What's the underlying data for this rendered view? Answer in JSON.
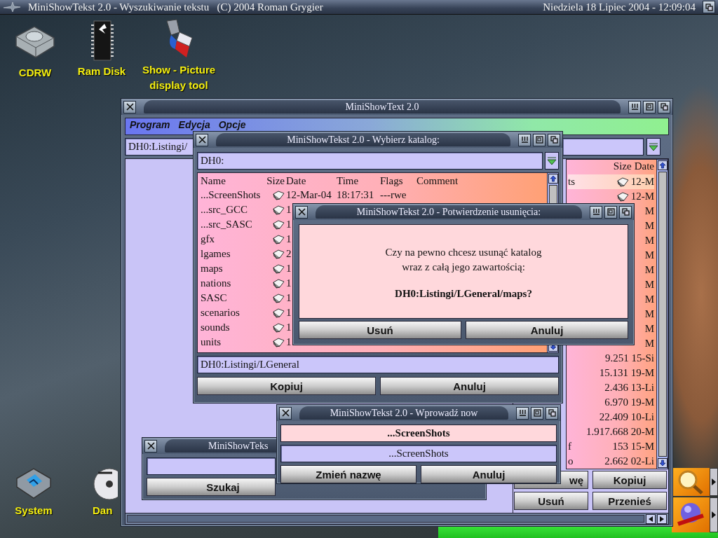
{
  "screen_bar": {
    "title": "MiniShowTekst 2.0 - Wyszukiwanie tekstu   (C) 2004 Roman Grygier",
    "clock": "Niedziela 18 Lipiec 2004 - 12:09:04"
  },
  "desktop_icons": [
    {
      "label": "CDRW",
      "kind": "cdrw"
    },
    {
      "label": "Ram Disk",
      "kind": "ram"
    },
    {
      "label": "Show - Picture display tool",
      "kind": "picture"
    },
    {
      "label": "System",
      "kind": "system"
    },
    {
      "label": "Dan",
      "kind": "cd"
    }
  ],
  "main_window": {
    "title": "MiniShowText 2.0",
    "menu": [
      "Program",
      "Edycja",
      "Opcje"
    ],
    "path": "DH0:Listingi/",
    "list_header": [
      "Size",
      "Date"
    ],
    "list_rows": [
      {
        "name": "ts",
        "size_date": "12-M",
        "kind": "dir",
        "selected": true
      },
      {
        "size_date": "12-M",
        "kind": "dir",
        "selected": false
      },
      {
        "size_date": "M",
        "kind": "file",
        "selected": false
      },
      {
        "size_date": "M",
        "kind": "file",
        "selected": false
      },
      {
        "size_date": "M",
        "kind": "file",
        "selected": false
      },
      {
        "size_date": "M",
        "kind": "file",
        "selected": false
      },
      {
        "size_date": "M",
        "kind": "file",
        "selected": false
      },
      {
        "size_date": "M",
        "kind": "file",
        "selected": false
      },
      {
        "size_date": "M",
        "kind": "file",
        "selected": false
      },
      {
        "size_date": "M",
        "kind": "file",
        "selected": false
      },
      {
        "size_date": "M",
        "kind": "file",
        "selected": false
      },
      {
        "size_date": "M",
        "kind": "file",
        "selected": false
      },
      {
        "size_date": "9.251 15-Si",
        "kind": "file",
        "selected": false
      },
      {
        "size_date": "15.131 19-M",
        "kind": "file",
        "selected": false
      },
      {
        "size_date": "2.436 13-Li",
        "kind": "file",
        "selected": false
      },
      {
        "size_date": "6.970 19-M",
        "kind": "file",
        "selected": false
      },
      {
        "size_date": "22.409 10-Li",
        "kind": "file",
        "selected": false
      },
      {
        "size_date": "1.917.668 20-M",
        "kind": "file",
        "selected": false
      },
      {
        "name": "f",
        "size_date": "153 15-M",
        "kind": "file",
        "selected": false
      },
      {
        "name": "o",
        "size_date": "2.662 02-Li",
        "kind": "file",
        "selected": false
      }
    ],
    "buttons": [
      "wę",
      "Kopiuj",
      "Usuń",
      "Przenieś"
    ]
  },
  "dir_window": {
    "title": "MiniShowTekst 2.0 - Wybierz katalog:",
    "volume": "DH0:",
    "columns": [
      "Name",
      "Size",
      "Date",
      "Time",
      "Flags",
      "Comment"
    ],
    "rows": [
      {
        "name": "...ScreenShots",
        "date": "12-Mar-04",
        "time": "18:17:31",
        "flags": "---rwe",
        "selected": false
      },
      {
        "name": "...src_GCC",
        "date": "1",
        "selected": false
      },
      {
        "name": "...src_SASC",
        "date": "1",
        "selected": false
      },
      {
        "name": "gfx",
        "date": "1",
        "selected": false
      },
      {
        "name": "lgames",
        "date": "2",
        "selected": false
      },
      {
        "name": "maps",
        "date": "1",
        "selected": false
      },
      {
        "name": "nations",
        "date": "1",
        "selected": false
      },
      {
        "name": "SASC",
        "date": "1",
        "selected": false
      },
      {
        "name": "scenarios",
        "date": "1",
        "selected": false
      },
      {
        "name": "sounds",
        "date": "1",
        "selected": false
      },
      {
        "name": "units",
        "date": "1",
        "selected": false
      }
    ],
    "path": "DH0:Listingi/LGeneral",
    "buttons": [
      "Kopiuj",
      "Anuluj"
    ]
  },
  "confirm_dialog": {
    "title": "MiniShowTekst 2.0 - Potwierdzenie usunięcia:",
    "message": [
      "Czy na pewno chcesz usunąć katalog",
      "wraz z całą jego zawartością:"
    ],
    "target": "DH0:Listingi/LGeneral/maps?",
    "buttons": [
      "Usuń",
      "Anuluj"
    ]
  },
  "search_window": {
    "title": "MiniShowTeks",
    "button": "Szukaj"
  },
  "rename_window": {
    "title": "MiniShowTekst 2.0 - Wprowadź now",
    "old_name": "...ScreenShots",
    "new_name": "...ScreenShots",
    "buttons": [
      "Zmień nazwę",
      "Anuluj"
    ]
  }
}
